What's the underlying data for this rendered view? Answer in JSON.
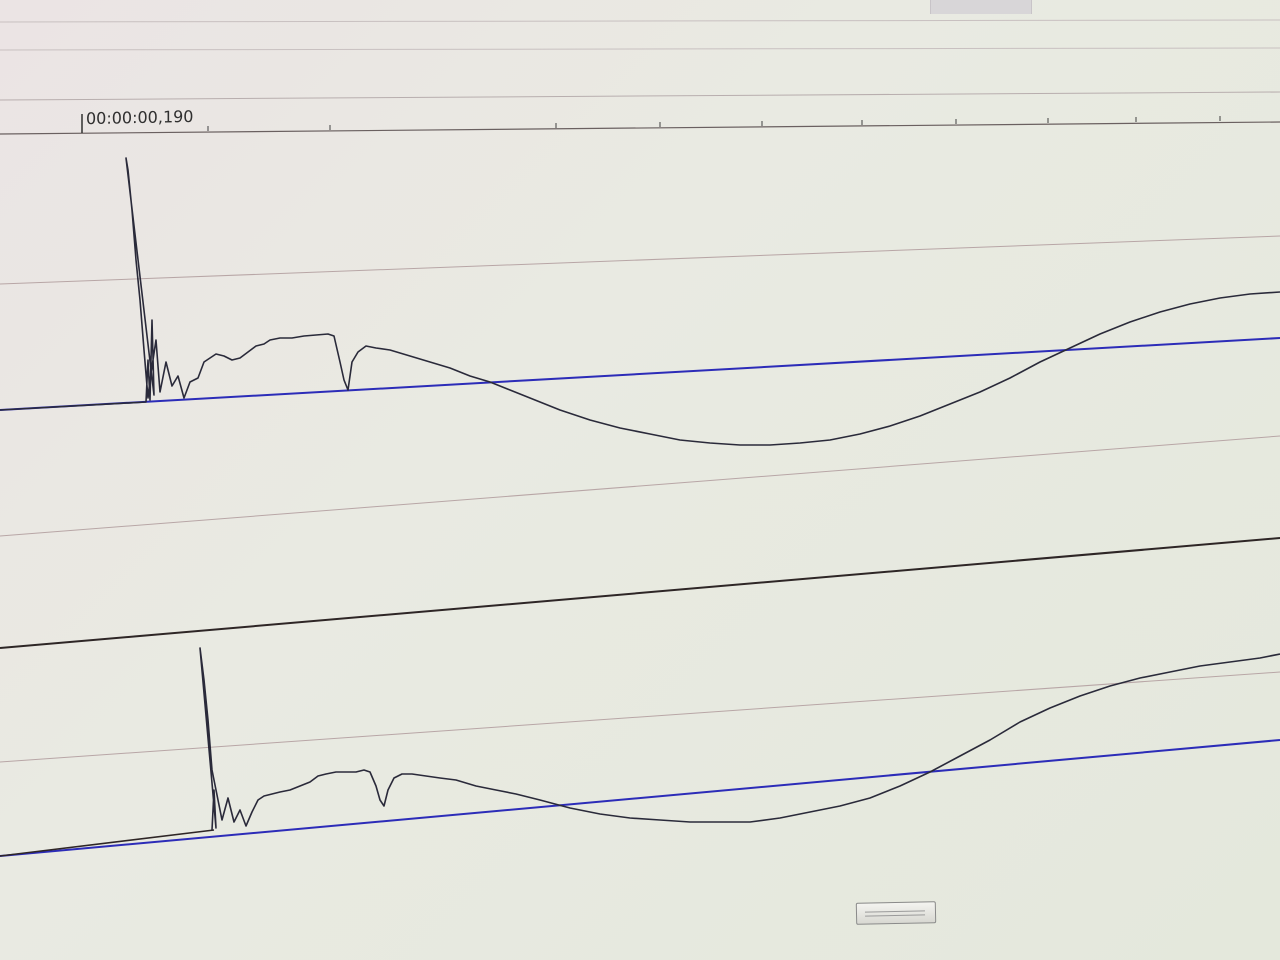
{
  "timeline": {
    "cursor_time": "00:00:00,190"
  },
  "colors": {
    "waveform": "#2a2a3a",
    "center_line": "#2c2cb8",
    "track_border": "#2e2626",
    "grid_line": "#b8a6a6"
  },
  "tracks": [
    {
      "name": "waveform-track-1"
    },
    {
      "name": "waveform-track-2"
    }
  ],
  "scrollbar": {
    "icon": "scroll-thumb"
  }
}
